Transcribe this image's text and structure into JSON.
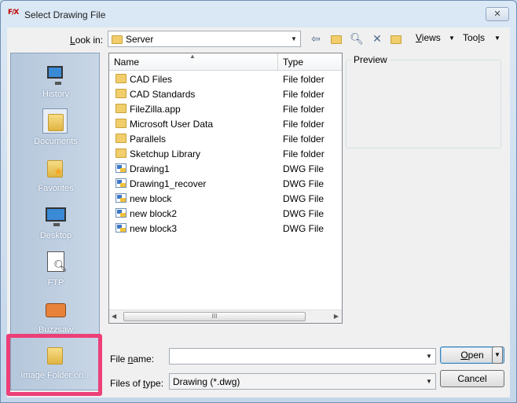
{
  "window": {
    "title": "Select Drawing File",
    "app_icon_text": "F/X",
    "close_glyph": "✕"
  },
  "toolbar": {
    "look_in_label": "Look in:",
    "look_in_value": "Server",
    "views_label": "Views",
    "tools_label": "Tools",
    "icons": [
      "back-icon",
      "up-folder-icon",
      "search-web-icon",
      "delete-icon",
      "new-folder-icon"
    ]
  },
  "places": [
    {
      "label": "History",
      "icon": "history-icon"
    },
    {
      "label": "Documents",
      "icon": "documents-folder-icon"
    },
    {
      "label": "Favorites",
      "icon": "favorites-folder-icon"
    },
    {
      "label": "Desktop",
      "icon": "desktop-icon"
    },
    {
      "label": "FTP",
      "icon": "ftp-icon"
    },
    {
      "label": "Buzzsaw",
      "icon": "buzzsaw-icon"
    },
    {
      "label": "Image Folder on...",
      "icon": "image-folder-icon"
    }
  ],
  "filelist": {
    "columns": {
      "name": "Name",
      "type": "Type"
    },
    "rows": [
      {
        "name": "CAD Files",
        "type": "File folder",
        "kind": "folder"
      },
      {
        "name": "CAD Standards",
        "type": "File folder",
        "kind": "folder"
      },
      {
        "name": "FileZilla.app",
        "type": "File folder",
        "kind": "folder"
      },
      {
        "name": "Microsoft User Data",
        "type": "File folder",
        "kind": "folder"
      },
      {
        "name": "Parallels",
        "type": "File folder",
        "kind": "folder"
      },
      {
        "name": "Sketchup Library",
        "type": "File folder",
        "kind": "folder"
      },
      {
        "name": "Drawing1",
        "type": "DWG File",
        "kind": "dwg"
      },
      {
        "name": "Drawing1_recover",
        "type": "DWG File",
        "kind": "dwg"
      },
      {
        "name": "new block",
        "type": "DWG File",
        "kind": "dwg"
      },
      {
        "name": "new block2",
        "type": "DWG File",
        "kind": "dwg"
      },
      {
        "name": "new block3",
        "type": "DWG File",
        "kind": "dwg"
      }
    ],
    "scroll_grip": "III"
  },
  "preview": {
    "label": "Preview"
  },
  "bottom": {
    "file_name_label": "File name:",
    "file_name_value": "",
    "files_of_type_label": "Files of type:",
    "files_of_type_value": "Drawing (*.dwg)",
    "open_label": "Open",
    "cancel_label": "Cancel"
  },
  "colors": {
    "highlight": "#ec3f78",
    "places_bg": "#b5c7db",
    "folder": "#f1ce6b"
  }
}
